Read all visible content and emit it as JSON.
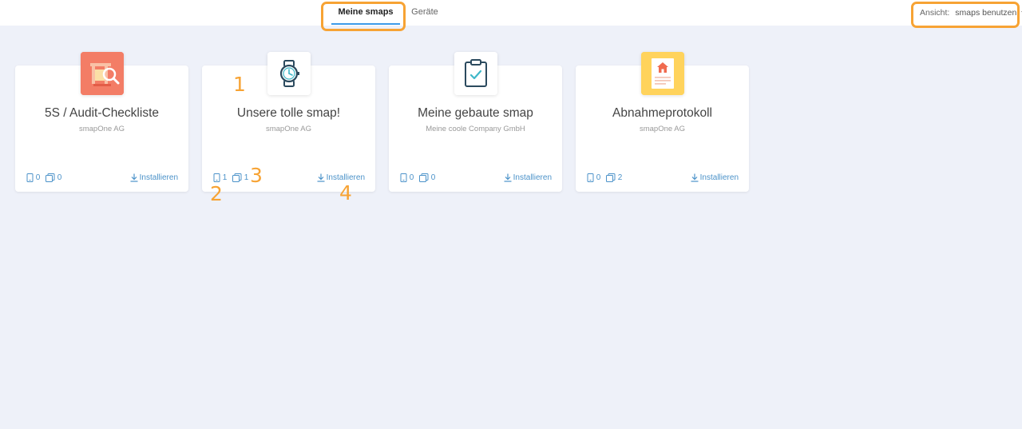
{
  "nav": {
    "tabs": [
      {
        "label": "Meine smaps",
        "active": true
      },
      {
        "label": "Geräte",
        "active": false
      }
    ]
  },
  "view": {
    "label": "Ansicht:",
    "value": "smaps benutzen"
  },
  "cards": [
    {
      "title": "5S / Audit-Checkliste",
      "company": "smapOne AG",
      "devices": "0",
      "copies": "0",
      "install_label": "Installieren",
      "icon": "audit-magnifier-icon",
      "icon_bg": "#f37d66"
    },
    {
      "title": "Unsere tolle smap!",
      "company": "smapOne AG",
      "devices": "1",
      "copies": "1",
      "install_label": "Installieren",
      "icon": "watch-icon",
      "icon_bg": "#ffffff"
    },
    {
      "title": "Meine gebaute smap",
      "company": "Meine coole Company GmbH",
      "devices": "0",
      "copies": "0",
      "install_label": "Installieren",
      "icon": "clipboard-check-icon",
      "icon_bg": "#ffffff"
    },
    {
      "title": "Abnahmeprotokoll",
      "company": "smapOne AG",
      "devices": "0",
      "copies": "2",
      "install_label": "Installieren",
      "icon": "house-document-icon",
      "icon_bg": "#ffd35c"
    }
  ],
  "annotations": [
    "1",
    "2",
    "3",
    "4"
  ],
  "colors": {
    "accent": "#3d9be9",
    "highlight": "#f7a334",
    "link": "#4b92c9",
    "background": "#eef1f9"
  }
}
